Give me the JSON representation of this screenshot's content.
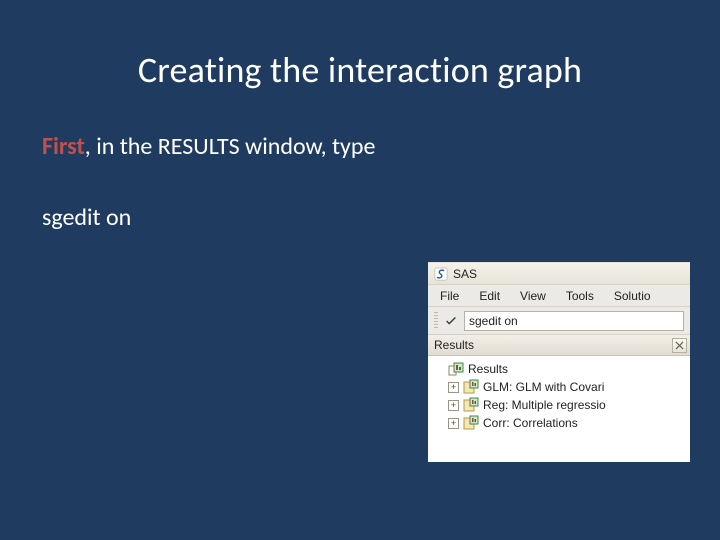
{
  "slide": {
    "title": "Creating the interaction graph",
    "first_word": "First",
    "body_rest": ", in the RESULTS window, type",
    "command": "sgedit on"
  },
  "sas": {
    "app_name": "SAS",
    "menu": {
      "file": "File",
      "edit": "Edit",
      "view": "View",
      "tools": "Tools",
      "solutions": "Solutio"
    },
    "cmd_value": "sgedit on",
    "panel_title": "Results",
    "tree": {
      "root": "Results",
      "items": [
        {
          "label": "GLM: GLM with Covari"
        },
        {
          "label": "Reg: Multiple regressio"
        },
        {
          "label": "Corr: Correlations"
        }
      ],
      "expander_glyph": "+"
    }
  }
}
